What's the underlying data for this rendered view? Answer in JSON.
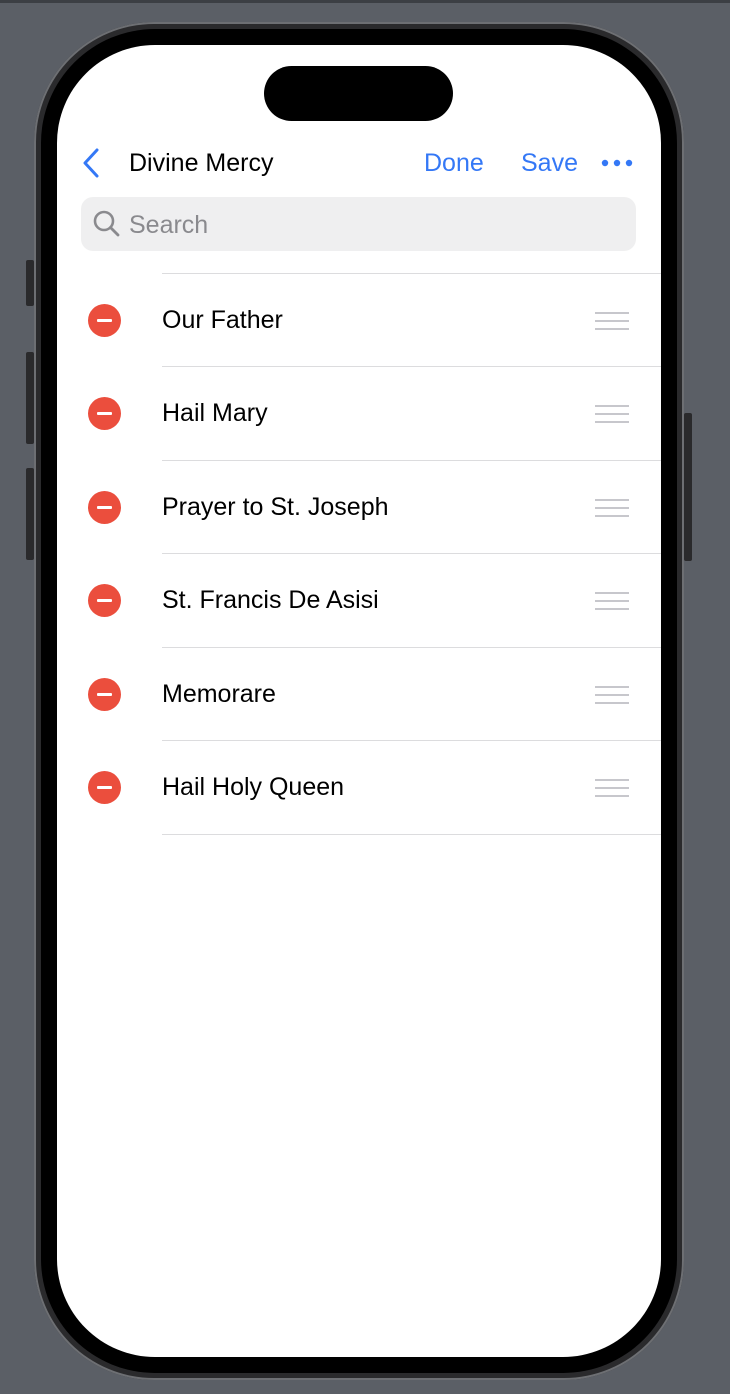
{
  "nav": {
    "title": "Divine Mercy",
    "done_label": "Done",
    "save_label": "Save"
  },
  "search": {
    "placeholder": "Search",
    "value": ""
  },
  "list": {
    "items": [
      {
        "label": "Our Father"
      },
      {
        "label": "Hail Mary"
      },
      {
        "label": "Prayer to St. Joseph"
      },
      {
        "label": "St. Francis De Asisi"
      },
      {
        "label": "Memorare"
      },
      {
        "label": "Hail Holy Queen"
      }
    ]
  },
  "colors": {
    "accent": "#3478f6",
    "delete": "#eb4e3d",
    "separator": "#dcdcde",
    "search_bg": "#efeff0"
  },
  "icons": {
    "back": "chevron-left-icon",
    "more": "ellipsis-icon",
    "search": "magnifier-icon",
    "delete": "minus-circle-icon",
    "reorder": "reorder-grip-icon"
  }
}
